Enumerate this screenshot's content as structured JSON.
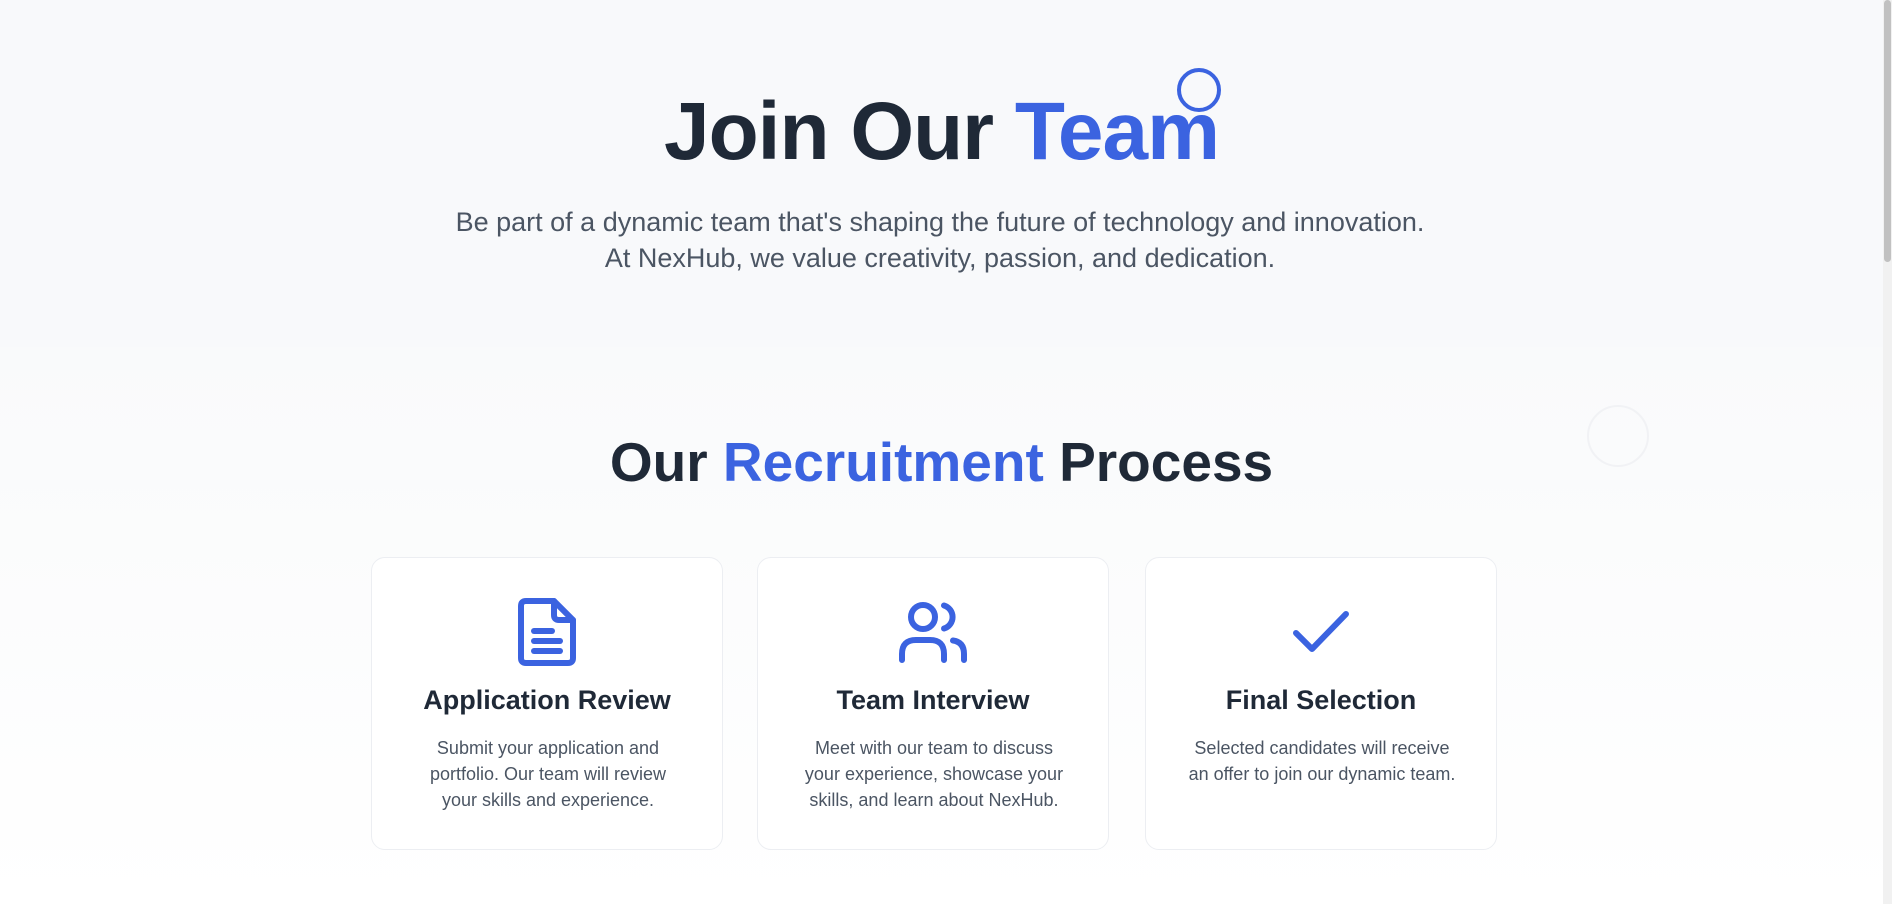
{
  "hero": {
    "title_part1": "Join Our ",
    "title_accent": "Team",
    "subtitle": "Be part of a dynamic team that's shaping the future of technology and innovation. At NexHub, we value creativity, passion, and dedication."
  },
  "process": {
    "title_part1": "Our ",
    "title_accent": "Recruitment",
    "title_part2": " Process",
    "steps": [
      {
        "icon": "document-icon",
        "title": "Application Review",
        "text": "Submit your application and portfolio. Our team will review your skills and experience."
      },
      {
        "icon": "users-icon",
        "title": "Team Interview",
        "text": "Meet with our team to discuss your experience, showcase your skills, and learn about NexHub."
      },
      {
        "icon": "checkmark-icon",
        "title": "Final Selection",
        "text": "Selected candidates will receive an offer to join our dynamic team."
      }
    ]
  },
  "colors": {
    "accent": "#3b63e0",
    "heading": "#1f2937",
    "body_text": "#4b5563",
    "hero_background": "#f8f9fb"
  }
}
